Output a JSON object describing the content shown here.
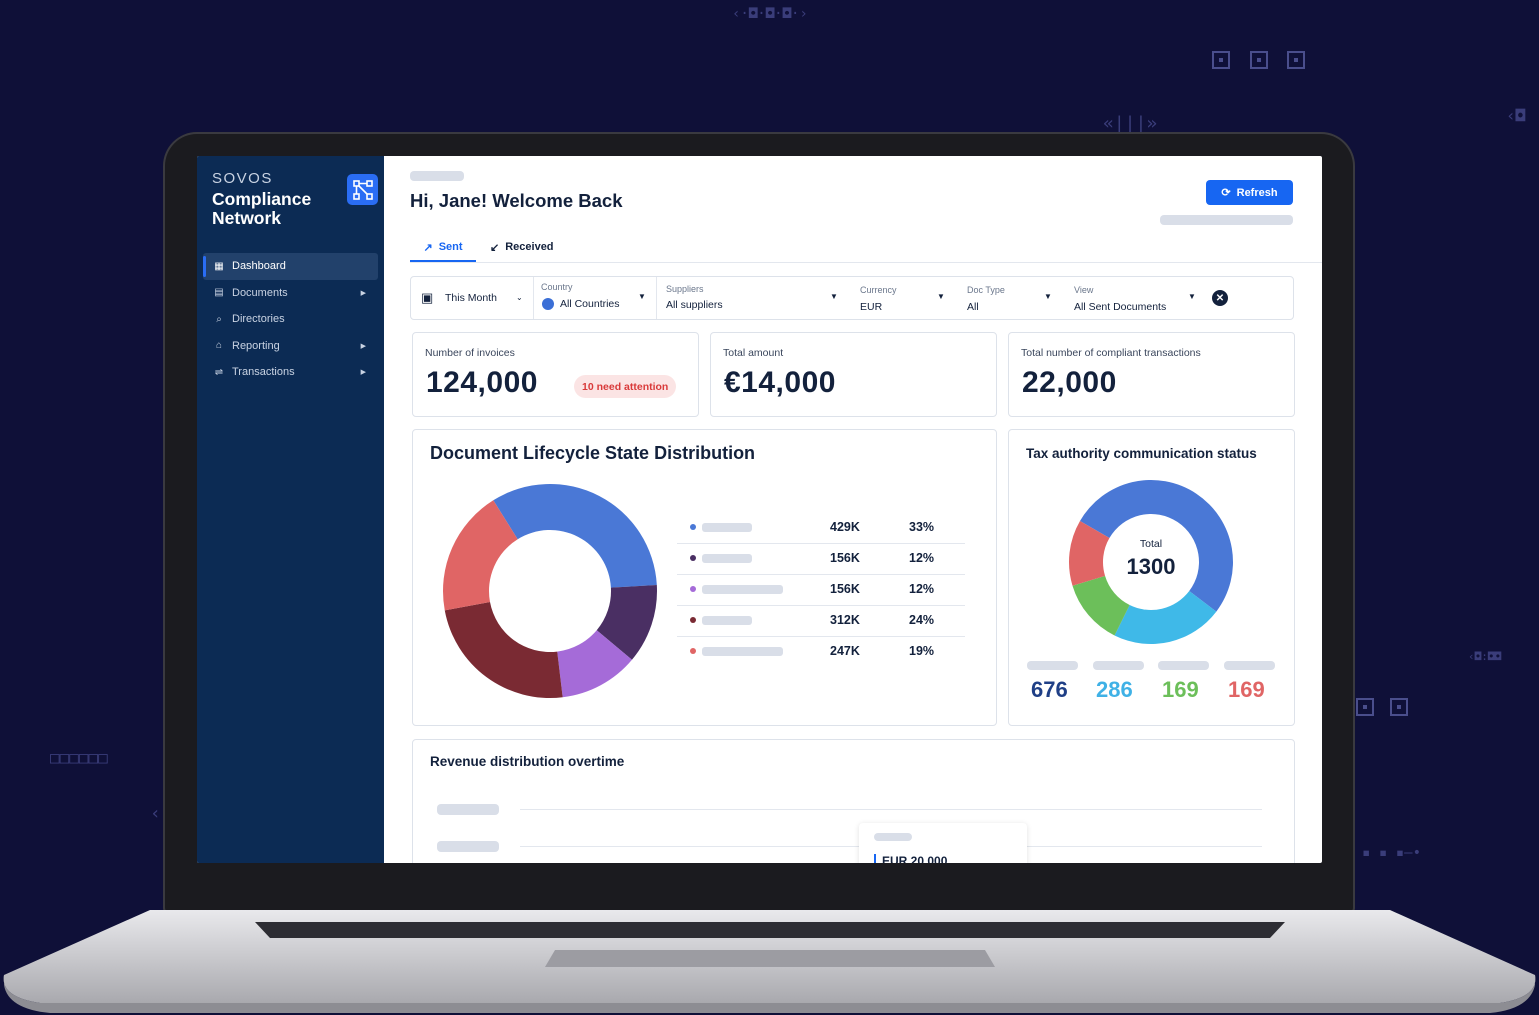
{
  "brand": {
    "small": "SOVOS",
    "name": "Compliance Network"
  },
  "sidebar": {
    "items": [
      {
        "label": "Dashboard",
        "icon": "dashboard-icon"
      },
      {
        "label": "Documents",
        "icon": "document-icon"
      },
      {
        "label": "Directories",
        "icon": "directory-search-icon"
      },
      {
        "label": "Reporting",
        "icon": "bank-icon"
      },
      {
        "label": "Transactions",
        "icon": "transactions-icon"
      }
    ]
  },
  "header": {
    "greeting": "Hi, Jane! Welcome Back",
    "refresh_label": "Refresh"
  },
  "tabs": [
    {
      "label": "Sent"
    },
    {
      "label": "Received"
    }
  ],
  "filters": {
    "period": "This Month",
    "country": {
      "label": "Country",
      "value": "All Countries"
    },
    "suppliers": {
      "label": "Suppliers",
      "value": "All suppliers"
    },
    "currency": {
      "label": "Currency",
      "value": "EUR"
    },
    "doc_type": {
      "label": "Doc Type",
      "value": "All"
    },
    "view": {
      "label": "View",
      "value": "All Sent Documents"
    }
  },
  "stats": {
    "invoices": {
      "label": "Number of invoices",
      "value": "124,000",
      "badge": "10 need attention"
    },
    "amount": {
      "label": "Total amount",
      "value": "€14,000"
    },
    "compliant": {
      "label": "Total number of compliant transactions",
      "value": "22,000"
    }
  },
  "lifecycle": {
    "title": "Document Lifecycle State Distribution",
    "rows": [
      {
        "value": "429K",
        "pct": "33%",
        "color": "#4a78d6"
      },
      {
        "value": "156K",
        "pct": "12%",
        "color": "#4a2f63"
      },
      {
        "value": "156K",
        "pct": "12%",
        "color": "#a56bd8"
      },
      {
        "value": "312K",
        "pct": "24%",
        "color": "#7a2a33"
      },
      {
        "value": "247K",
        "pct": "19%",
        "color": "#e06565"
      }
    ]
  },
  "chart_data": {
    "type": "pie",
    "title": "Document Lifecycle State Distribution",
    "values": [
      33,
      12,
      12,
      24,
      19
    ],
    "labels": [
      "429K",
      "156K",
      "156K",
      "312K",
      "247K"
    ],
    "colors": [
      "#4a78d6",
      "#4a2f63",
      "#a56bd8",
      "#7a2a33",
      "#e06565"
    ]
  },
  "tax": {
    "title": "Tax authority communication status",
    "total_label": "Total",
    "total_value": "1300",
    "counts": [
      {
        "value": "676",
        "color": "#1f3f86"
      },
      {
        "value": "286",
        "color": "#3fb1e6"
      },
      {
        "value": "169",
        "color": "#6cbf5a"
      },
      {
        "value": "169",
        "color": "#e06565"
      }
    ],
    "donut": [
      676,
      286,
      169,
      169
    ],
    "donut_colors": [
      "#4a78d6",
      "#3fb9e8",
      "#6cbf5a",
      "#e06565"
    ]
  },
  "revenue": {
    "title": "Revenue distribution overtime",
    "tooltip_value": "EUR 20,000"
  }
}
